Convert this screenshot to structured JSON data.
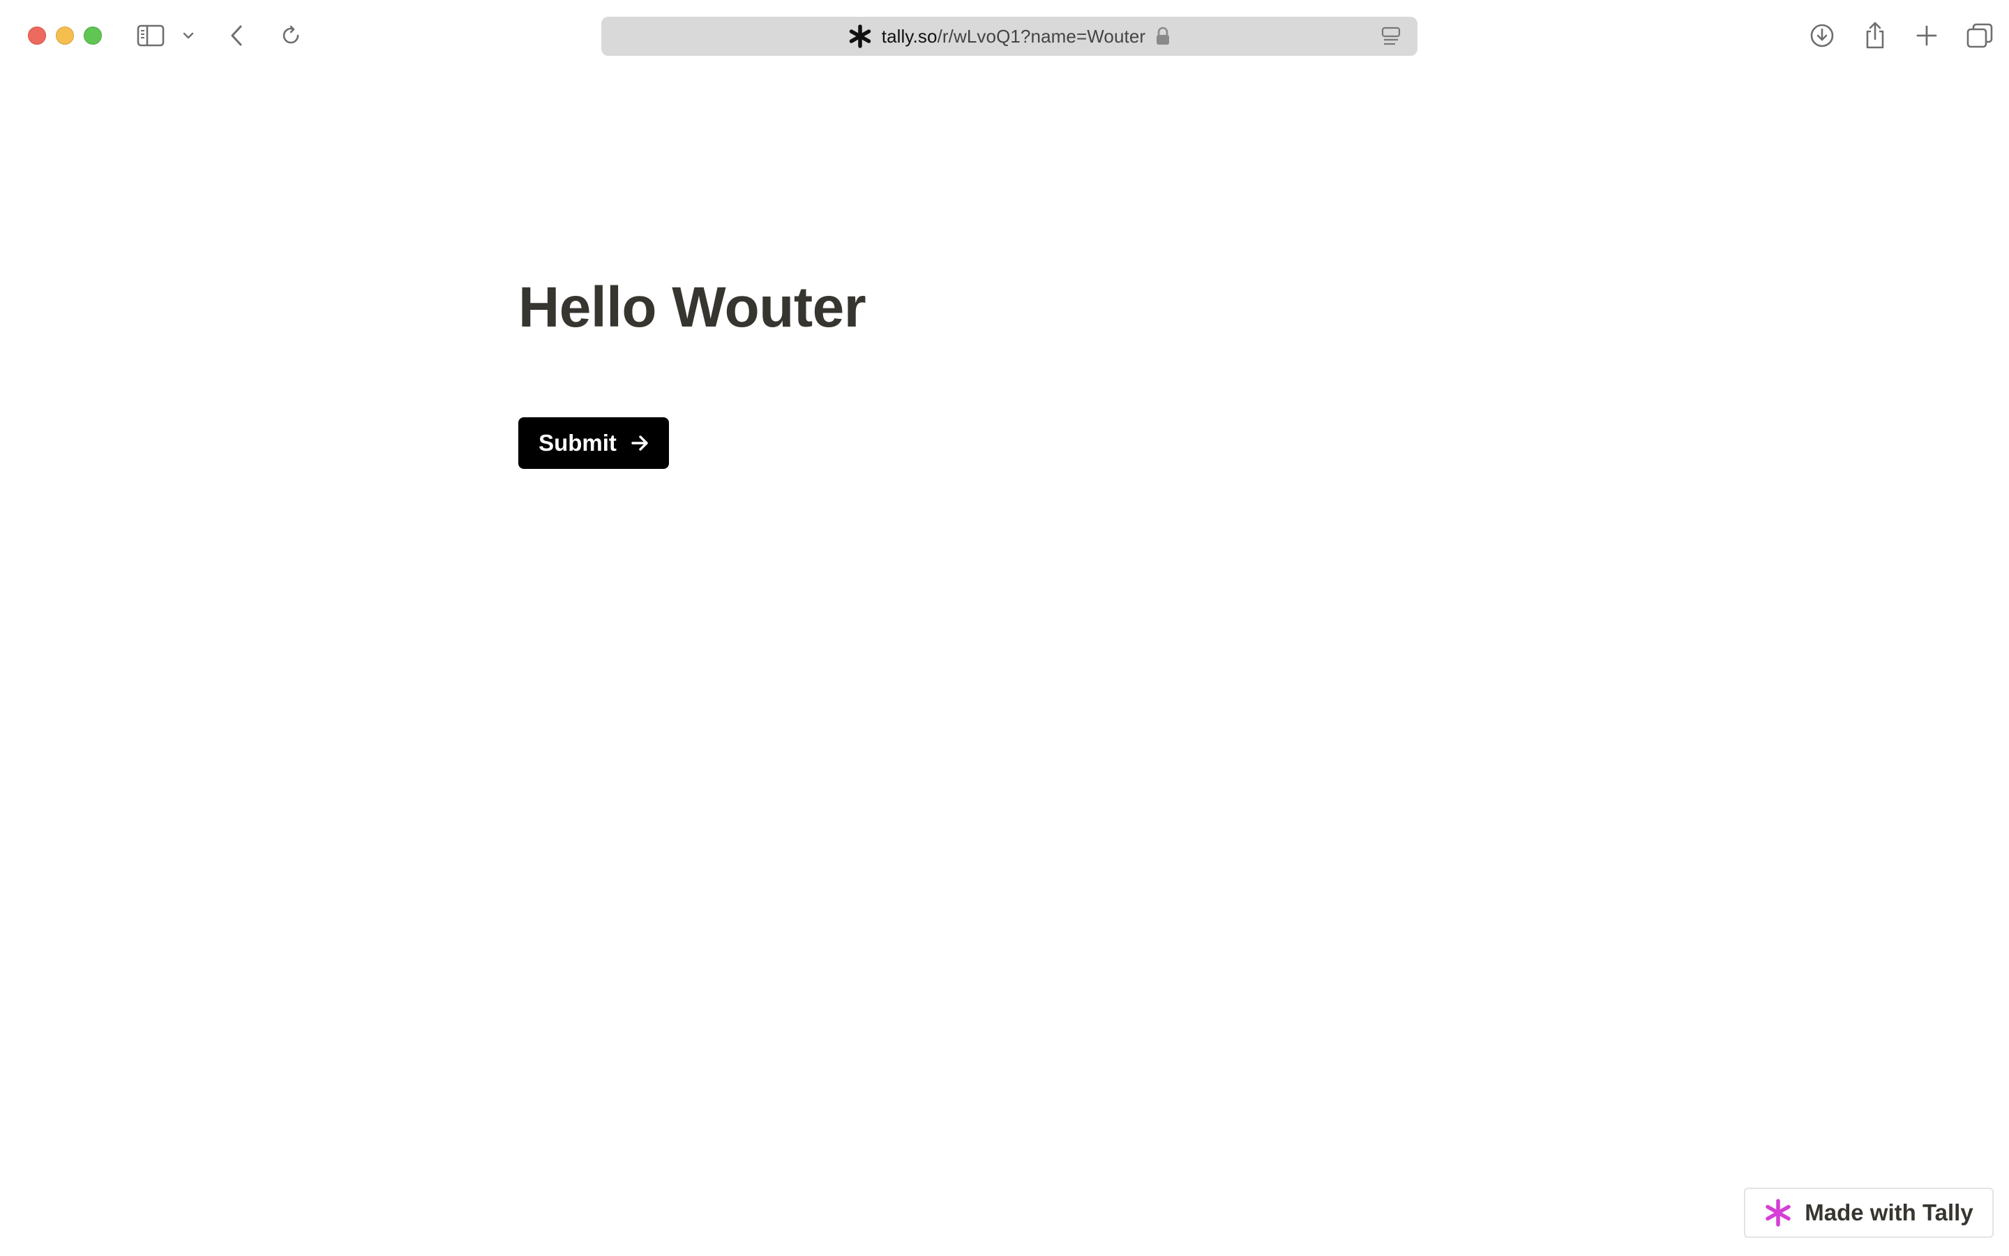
{
  "browser": {
    "url_domain": "tally.so",
    "url_path": "/r/wLvoQ1?name=Wouter",
    "icons": [
      "sidebar-icon",
      "chevron-down-icon",
      "back-icon",
      "reload-icon",
      "lock-icon",
      "reader-icon",
      "download-icon",
      "share-icon",
      "new-tab-icon",
      "tabs-overview-icon"
    ]
  },
  "page": {
    "heading": "Hello Wouter",
    "submit_label": "Submit",
    "badge_label": "Made with Tally"
  },
  "colors": {
    "heading": "#37352f",
    "submit_bg": "#000000",
    "tally_brand": "#d53fd6",
    "address_bg": "#d9d9d9"
  }
}
